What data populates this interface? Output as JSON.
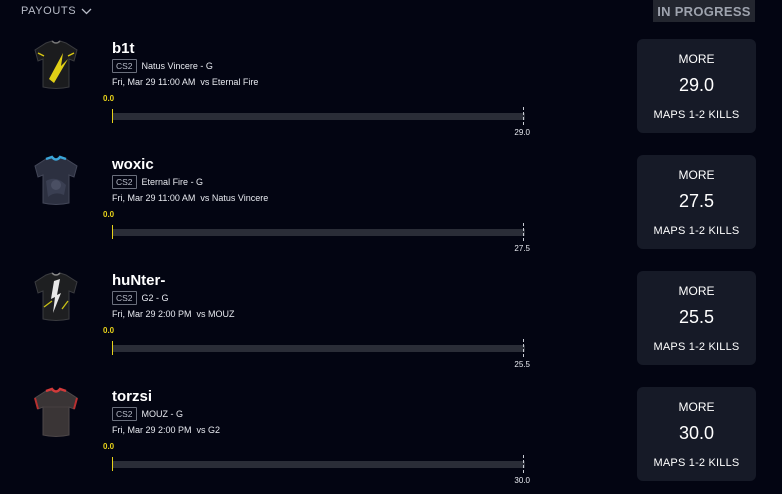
{
  "header": {
    "payouts_label": "PAYOUTS",
    "status_badge": "IN PROGRESS"
  },
  "colors": {
    "background": "#030512",
    "progress_accent": "#e7d21a",
    "card_box": "#161a27",
    "badge_bg": "#23262f"
  },
  "props": [
    {
      "player": "b1t",
      "game": "CS2",
      "team_pos": "Natus Vincere - G",
      "datetime": "Fri, Mar 29 11:00 AM",
      "opponent": "vs Eternal Fire",
      "current": "0.0",
      "target": "29.0",
      "progress": 0,
      "direction": "MORE",
      "line": "29.0",
      "stat": "MAPS 1-2 KILLS",
      "jersey_icon": "jersey-navi-icon"
    },
    {
      "player": "woxic",
      "game": "CS2",
      "team_pos": "Eternal Fire - G",
      "datetime": "Fri, Mar 29 11:00 AM",
      "opponent": "vs Natus Vincere",
      "current": "0.0",
      "target": "27.5",
      "progress": 0,
      "direction": "MORE",
      "line": "27.5",
      "stat": "MAPS 1-2 KILLS",
      "jersey_icon": "jersey-eternal-fire-icon"
    },
    {
      "player": "huNter-",
      "game": "CS2",
      "team_pos": "G2 - G",
      "datetime": "Fri, Mar 29 2:00 PM",
      "opponent": "vs MOUZ",
      "current": "0.0",
      "target": "25.5",
      "progress": 0,
      "direction": "MORE",
      "line": "25.5",
      "stat": "MAPS 1-2 KILLS",
      "jersey_icon": "jersey-g2-icon"
    },
    {
      "player": "torzsi",
      "game": "CS2",
      "team_pos": "MOUZ - G",
      "datetime": "Fri, Mar 29 2:00 PM",
      "opponent": "vs G2",
      "current": "0.0",
      "target": "30.0",
      "progress": 0,
      "direction": "MORE",
      "line": "30.0",
      "stat": "MAPS 1-2 KILLS",
      "jersey_icon": "jersey-mouz-icon"
    }
  ]
}
